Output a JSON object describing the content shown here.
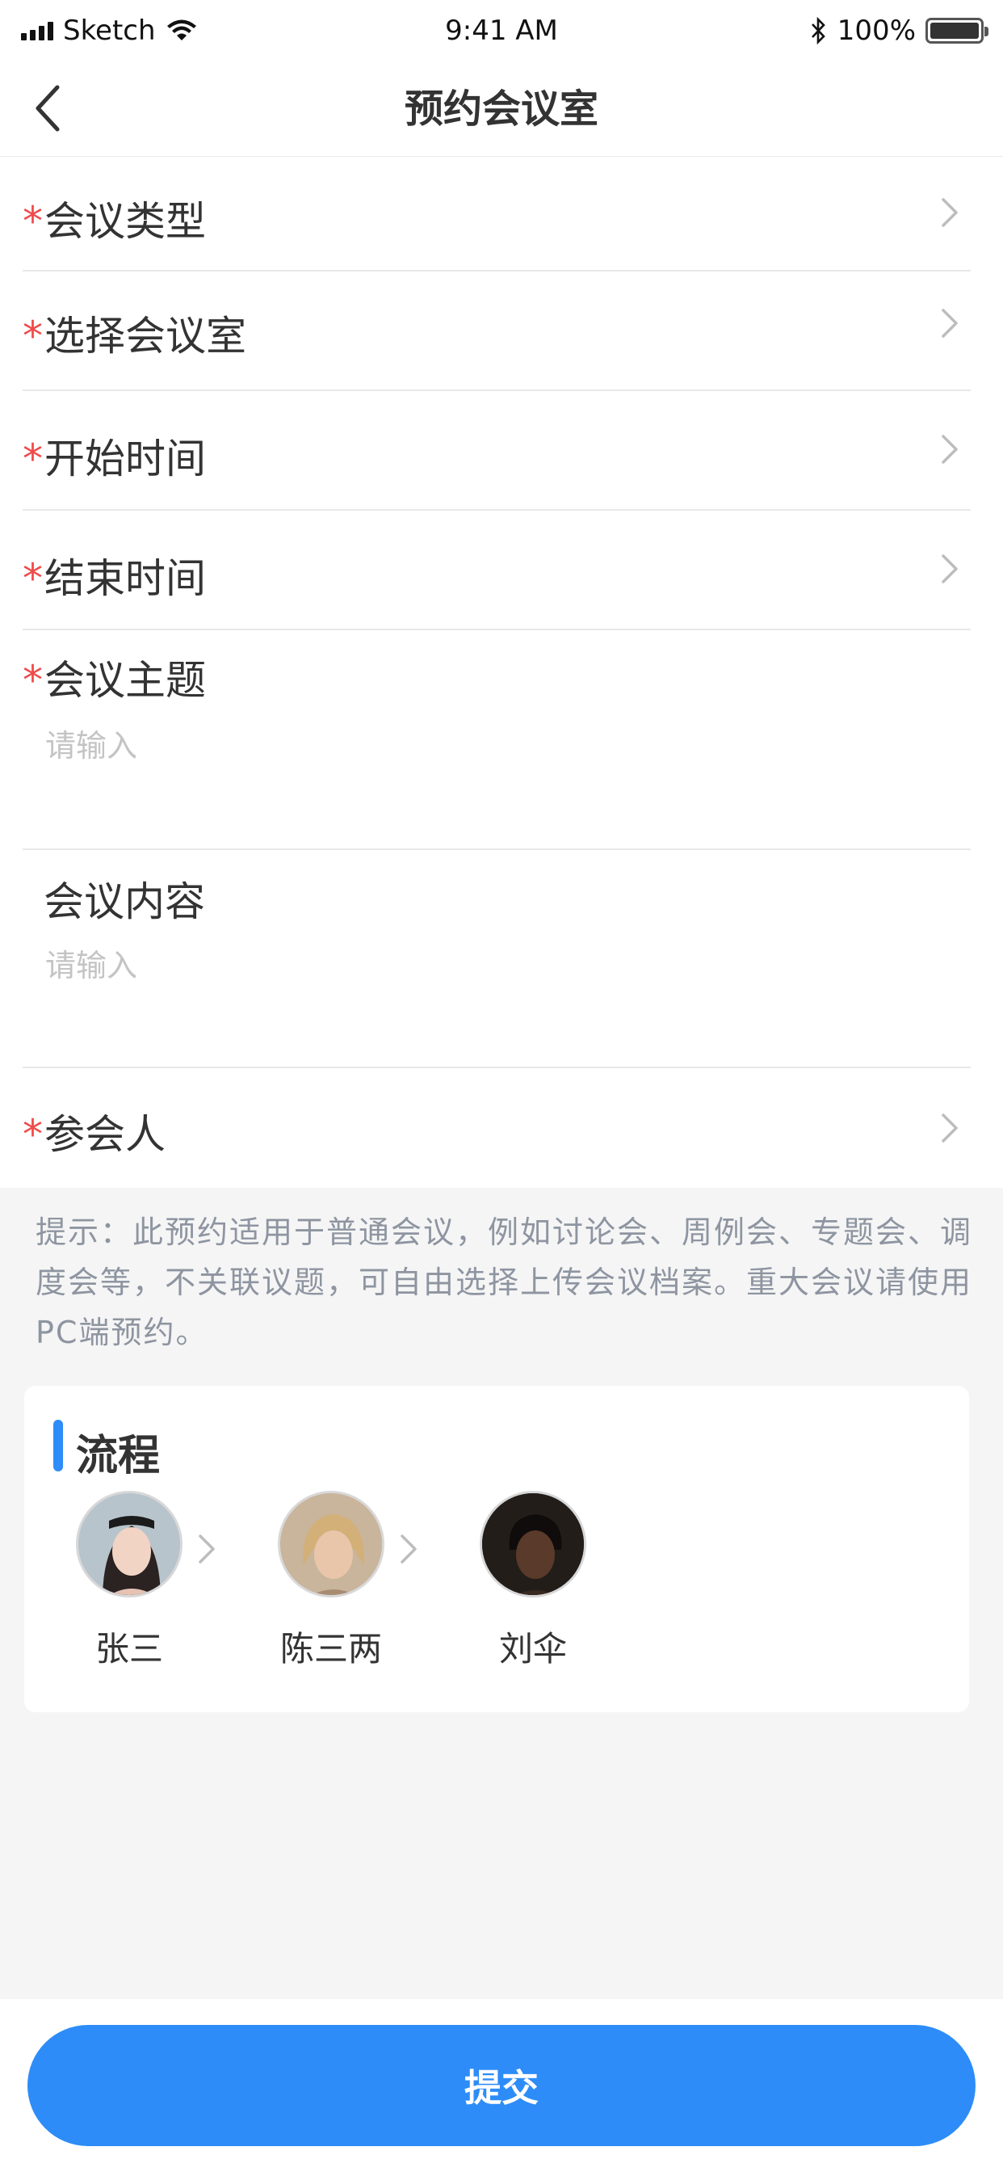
{
  "status_bar": {
    "carrier": "Sketch",
    "time": "9:41 AM",
    "battery_text": "100%",
    "battery_level": 1.0
  },
  "nav": {
    "title": "预约会议室",
    "back_icon": "chevron-left-icon"
  },
  "form": {
    "required_mark": "*",
    "rows": {
      "meeting_type": {
        "label": "会议类型",
        "required": true
      },
      "meeting_room": {
        "label": "选择会议室",
        "required": true
      },
      "start_time": {
        "label": "开始时间",
        "required": true
      },
      "end_time": {
        "label": "结束时间",
        "required": true
      },
      "subject": {
        "label": "会议主题",
        "required": true,
        "placeholder": "请输入"
      },
      "content": {
        "label": "会议内容",
        "required": false,
        "placeholder": "请输入"
      },
      "attendees": {
        "label": "参会人",
        "required": true
      }
    }
  },
  "tip": {
    "text": "提示：此预约适用于普通会议，例如讨论会、周例会、专题会、调度会等，不关联议题，可自由选择上传会议档案。重大会议请使用PC端预约。"
  },
  "flow": {
    "title": "流程",
    "accent_color": "#2d8cf8",
    "people": [
      {
        "name": "张三"
      },
      {
        "name": "陈三两"
      },
      {
        "name": "刘伞"
      }
    ]
  },
  "footer": {
    "submit_label": "提交",
    "button_color": "#2d8cf8"
  }
}
